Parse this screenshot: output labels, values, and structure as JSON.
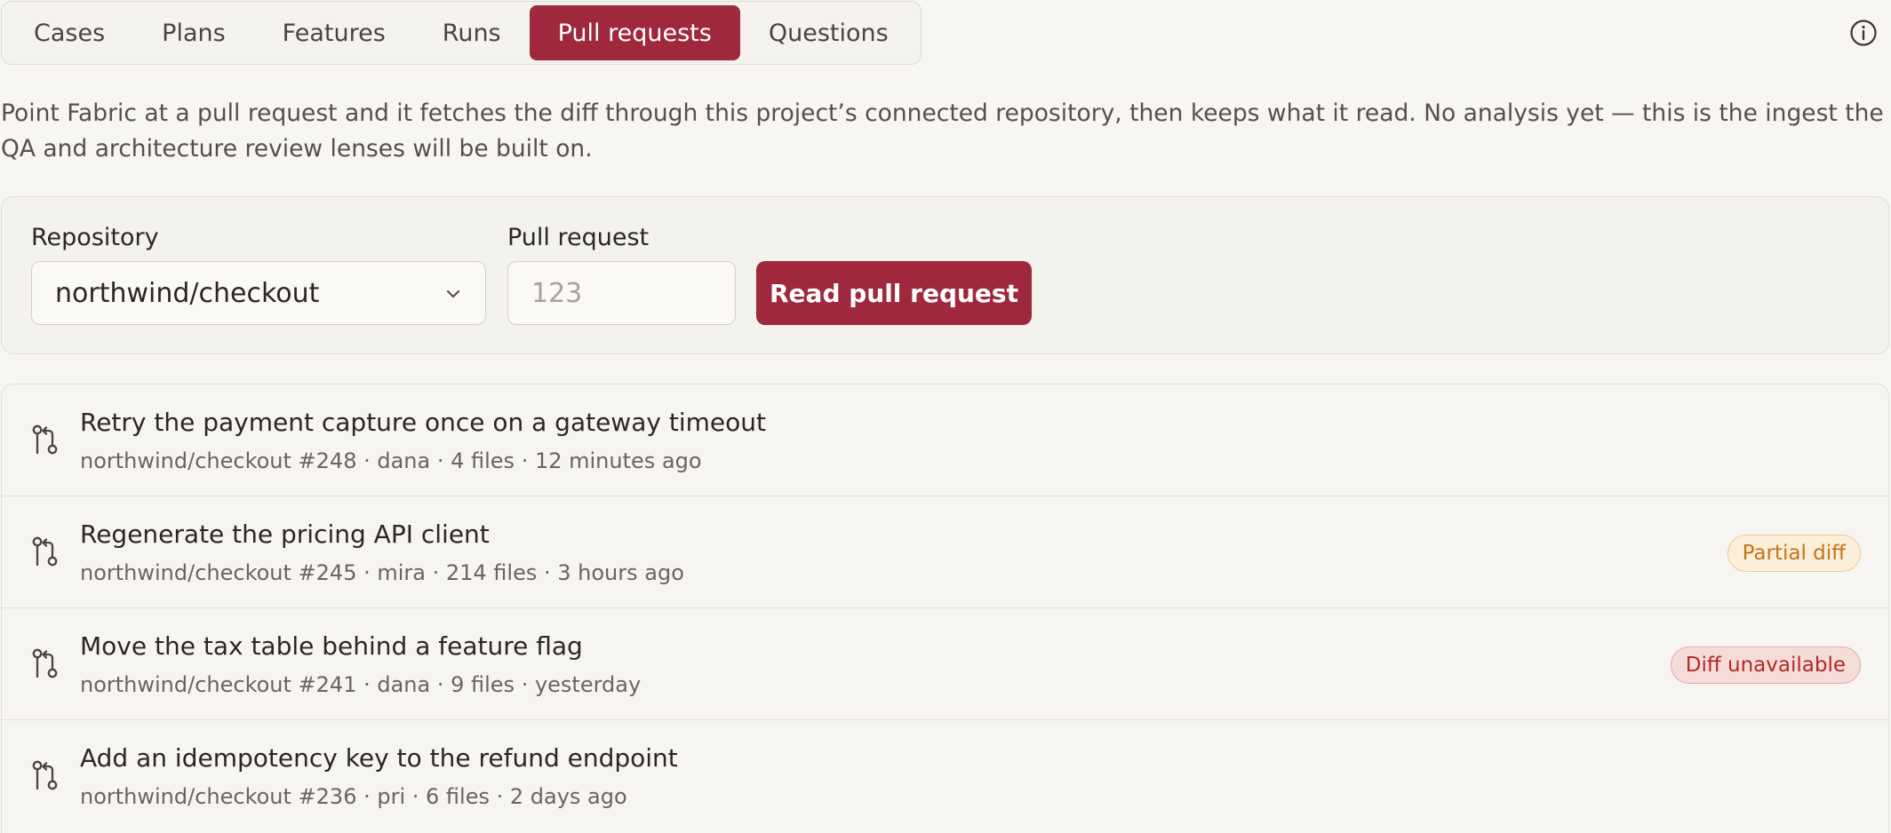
{
  "tabs": [
    {
      "label": "Cases",
      "active": false
    },
    {
      "label": "Plans",
      "active": false
    },
    {
      "label": "Features",
      "active": false
    },
    {
      "label": "Runs",
      "active": false
    },
    {
      "label": "Pull requests",
      "active": true
    },
    {
      "label": "Questions",
      "active": false
    }
  ],
  "header": {
    "info_icon": "info-circle-icon"
  },
  "intro": "Point Fabric at a pull request and it fetches the diff through this project’s connected repository, then keeps what it read. No analysis yet — this is the ingest the QA and architecture review lenses will be built on.",
  "form": {
    "repository_label": "Repository",
    "repository_value": "northwind/checkout",
    "pull_request_label": "Pull request",
    "pull_request_placeholder": "123",
    "submit_label": "Read pull request"
  },
  "pull_requests": [
    {
      "title": "Retry the payment capture once on a gateway timeout",
      "meta": "northwind/checkout #248 · dana · 4 files · 12 minutes ago",
      "badge": ""
    },
    {
      "title": "Regenerate the pricing API client",
      "meta": "northwind/checkout #245 · mira · 214 files · 3 hours ago",
      "badge": "Partial diff"
    },
    {
      "title": "Move the tax table behind a feature flag",
      "meta": "northwind/checkout #241 · dana · 9 files · yesterday",
      "badge": "Diff unavailable"
    },
    {
      "title": "Add an idempotency key to the refund endpoint",
      "meta": "northwind/checkout #236 · pri · 6 files · 2 days ago",
      "badge": ""
    }
  ],
  "colors": {
    "accent": "#a0283c",
    "background": "#f7f6f2",
    "partial_badge": "#c4741a",
    "unavailable_badge": "#b02a2a"
  }
}
